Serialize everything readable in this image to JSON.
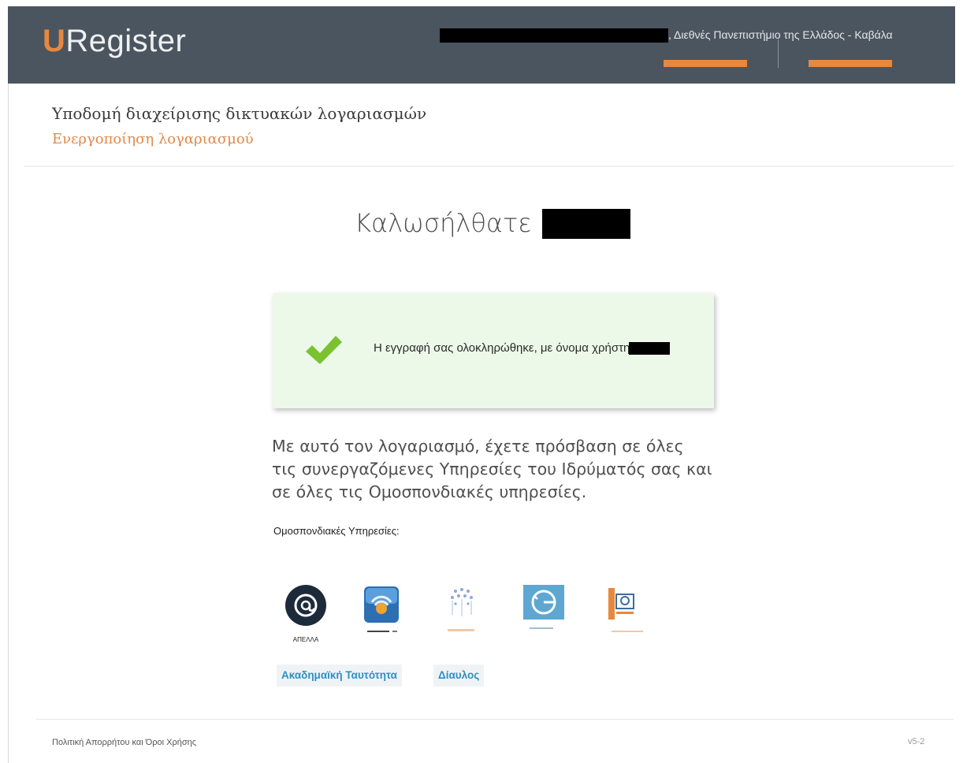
{
  "header": {
    "logo_prefix": "U",
    "logo_rest": "Register",
    "institution": ", Διεθνές Πανεπιστήμιο της Ελλάδος - Καβάλα",
    "accent_color": "#e8883c",
    "bar_color": "#4a5560"
  },
  "page": {
    "title": "Υποδομή διαχείρισης δικτυακών λογαριασμών",
    "subtitle": "Ενεργοποίηση λογαριασμού"
  },
  "welcome": {
    "text": "Καλωσήλθατε"
  },
  "success": {
    "icon": "checkmark-icon",
    "message": "Η εγγραφή σας ολοκληρώθηκε, με όνομα χρήστη ",
    "background": "#ecf9e9"
  },
  "info": {
    "access_text": "Με αυτό τον λογαριασμό, έχετε πρόσβαση σε όλες τις συνεργαζόμενες Υπηρεσίες του Ιδρύματός σας και σε όλες τις Ομοσπονδιακές υπηρεσίες.",
    "federated_label": "Ομοσπονδιακές Υπηρεσίες:"
  },
  "services": [
    {
      "icon": "apella-icon",
      "label": "ΑΠΕΛΛΑ"
    },
    {
      "icon": "wireless-network-icon"
    },
    {
      "icon": "stars-network-icon"
    },
    {
      "icon": "sync-circle-icon"
    },
    {
      "icon": "document-portal-icon"
    }
  ],
  "links": {
    "academic_id": "Ακαδημαϊκή Ταυτότητα",
    "diavlos": "Δίαυλος"
  },
  "footer": {
    "privacy": "Πολιτική Απορρήτου και Όροι Χρήσης",
    "version": "v5-2"
  }
}
